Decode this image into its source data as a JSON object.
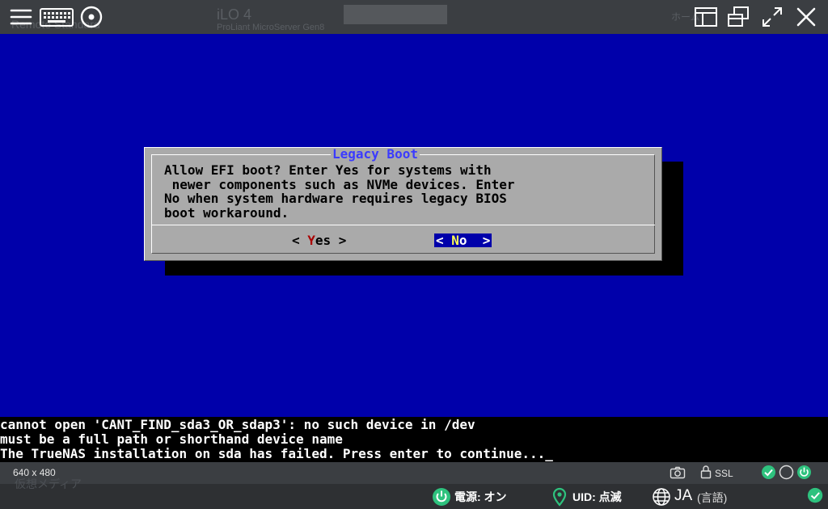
{
  "toolbar": {
    "menu_icon": "hamburger-icon",
    "keyboard_icon": "keyboard-icon",
    "media_icon": "disc-icon",
    "layout_icon": "layout-icon",
    "windows_icon": "windows-icon",
    "fullscreen_icon": "expand-icon",
    "close_icon": "close-icon",
    "bg_title": "iLO 4",
    "bg_subtitle": "ProLiant MicroServer Gen8",
    "bg_left": "Remote Standard",
    "bg_right": "ホーム"
  },
  "dialog": {
    "title": "Legacy Boot",
    "message": "Allow EFI boot? Enter Yes for systems with\n newer components such as NVMe devices. Enter\nNo when system hardware requires legacy BIOS\nboot workaround.",
    "yes_label": {
      "prefix": "< ",
      "hot": "Y",
      "rest": "es >"
    },
    "no_label": {
      "prefix": "< ",
      "hot": "N",
      "rest": "o  >"
    }
  },
  "terminal": {
    "lines": [
      "cannot open 'CANT_FIND_sda3_OR_sdap3': no such device in /dev",
      "must be a full path or shorthand device name",
      "The TrueNAS installation on sda has failed. Press enter to continue..._"
    ]
  },
  "status": {
    "resolution": "640 x 480",
    "camera_icon": "camera-icon",
    "lock_icon": "lock-icon",
    "ssl": "SSL",
    "indicators": [
      "check-circle-icon",
      "empty-circle-icon",
      "power-icon"
    ]
  },
  "footer": {
    "power_label": "電源: オン",
    "uid_label": "UID: 点滅",
    "lang_code": "JA",
    "lang_label": "(言語)",
    "ghost_text": "仮想メディア",
    "colors": {
      "accent": "#2ec27e",
      "console_bg": "#0000aa"
    }
  }
}
